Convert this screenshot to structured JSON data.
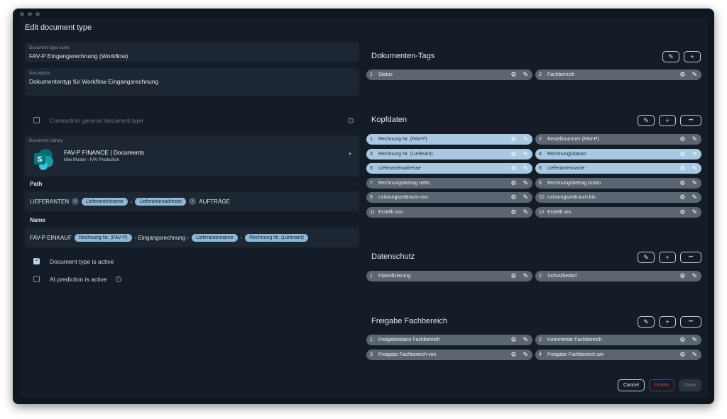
{
  "dialog": {
    "title": "Edit document type"
  },
  "form": {
    "name_label": "Document type name",
    "name_value": "FAV-P Eingangsrechnung (Workflow)",
    "desc_label": "Description",
    "desc_value": "Dokumententyp für Workflow Eingangsrechnung",
    "connection_label": "Connection general document type",
    "library_label": "Document Library",
    "library_title": "FAV-P FINANCE | Documents",
    "library_subtitle": "Max Muster - FAV Production",
    "path_label": "Path",
    "path": {
      "t1": "LIEFERANTEN",
      "p1": "Lieferantenname",
      "sep": "-",
      "p2": "Lieferantenadresse",
      "t2": "AUFTRÄGE"
    },
    "name_section_label": "Name",
    "name_parts": {
      "t1": "FAV-P EINKAUF",
      "p1": "Rechnung Nr. (FAV-P)",
      "t2": "- Eingangsrechnung -",
      "p2": "Lieferantenname",
      "sep": "-",
      "p3": "Rechnung Nr. (Lieferant)"
    },
    "active_label": "Document type is active",
    "ai_label": "AI prediction is active",
    "active_checked": true,
    "ai_checked": false
  },
  "sections": {
    "tags": {
      "title": "Dokumenten-Tags",
      "items": [
        {
          "num": "1",
          "name": "Status"
        },
        {
          "num": "2",
          "name": "Fachbereich"
        }
      ]
    },
    "kopf": {
      "title": "Kopfdaten",
      "items": [
        {
          "num": "1",
          "name": "Rechnung Nr. (FAV-P)"
        },
        {
          "num": "2",
          "name": "Bestellnummer (FAV-P)"
        },
        {
          "num": "3",
          "name": "Rechnung Nr. (Lieferant)"
        },
        {
          "num": "4",
          "name": "Rechnungsdatum"
        },
        {
          "num": "5",
          "name": "Lieferantenadresse"
        },
        {
          "num": "6",
          "name": "Lieferantenname"
        },
        {
          "num": "7",
          "name": "Rechnungsbetrag netto"
        },
        {
          "num": "8",
          "name": "Rechnungsbetrag brutto"
        },
        {
          "num": "9",
          "name": "Leistungszeitraum von"
        },
        {
          "num": "10",
          "name": "Leistungszeitraum bis"
        },
        {
          "num": "11",
          "name": "Erstellt von"
        },
        {
          "num": "12",
          "name": "Erstellt am"
        }
      ]
    },
    "daten": {
      "title": "Datenschutz",
      "items": [
        {
          "num": "1",
          "name": "Klassifizierung"
        },
        {
          "num": "2",
          "name": "Schutzbedarf"
        }
      ]
    },
    "frei": {
      "title": "Freigabe Fachbereich",
      "items": [
        {
          "num": "1",
          "name": "Freigabestatus Fachbereich"
        },
        {
          "num": "2",
          "name": "Kommentar Fachbereich"
        },
        {
          "num": "3",
          "name": "Freigabe Fachbereich von"
        },
        {
          "num": "4",
          "name": "Freigabe Fachbereich am"
        }
      ]
    }
  },
  "icons": {
    "edit": "pencil-icon",
    "add": "plus-icon",
    "more": "ellipsis-icon",
    "settings": "gear-icon"
  },
  "glyphs": {
    "edit": "✎",
    "add": "+",
    "more": "•••",
    "settings": "⚙",
    "chevron": "›",
    "info": "i",
    "caret": "▼"
  },
  "footer": {
    "cancel": "Cancel",
    "delete": "Delete",
    "save": "Save"
  },
  "colors": {
    "highlight": "#a9c9e2",
    "tag": "#5b6672",
    "delete": "#c0413f"
  }
}
